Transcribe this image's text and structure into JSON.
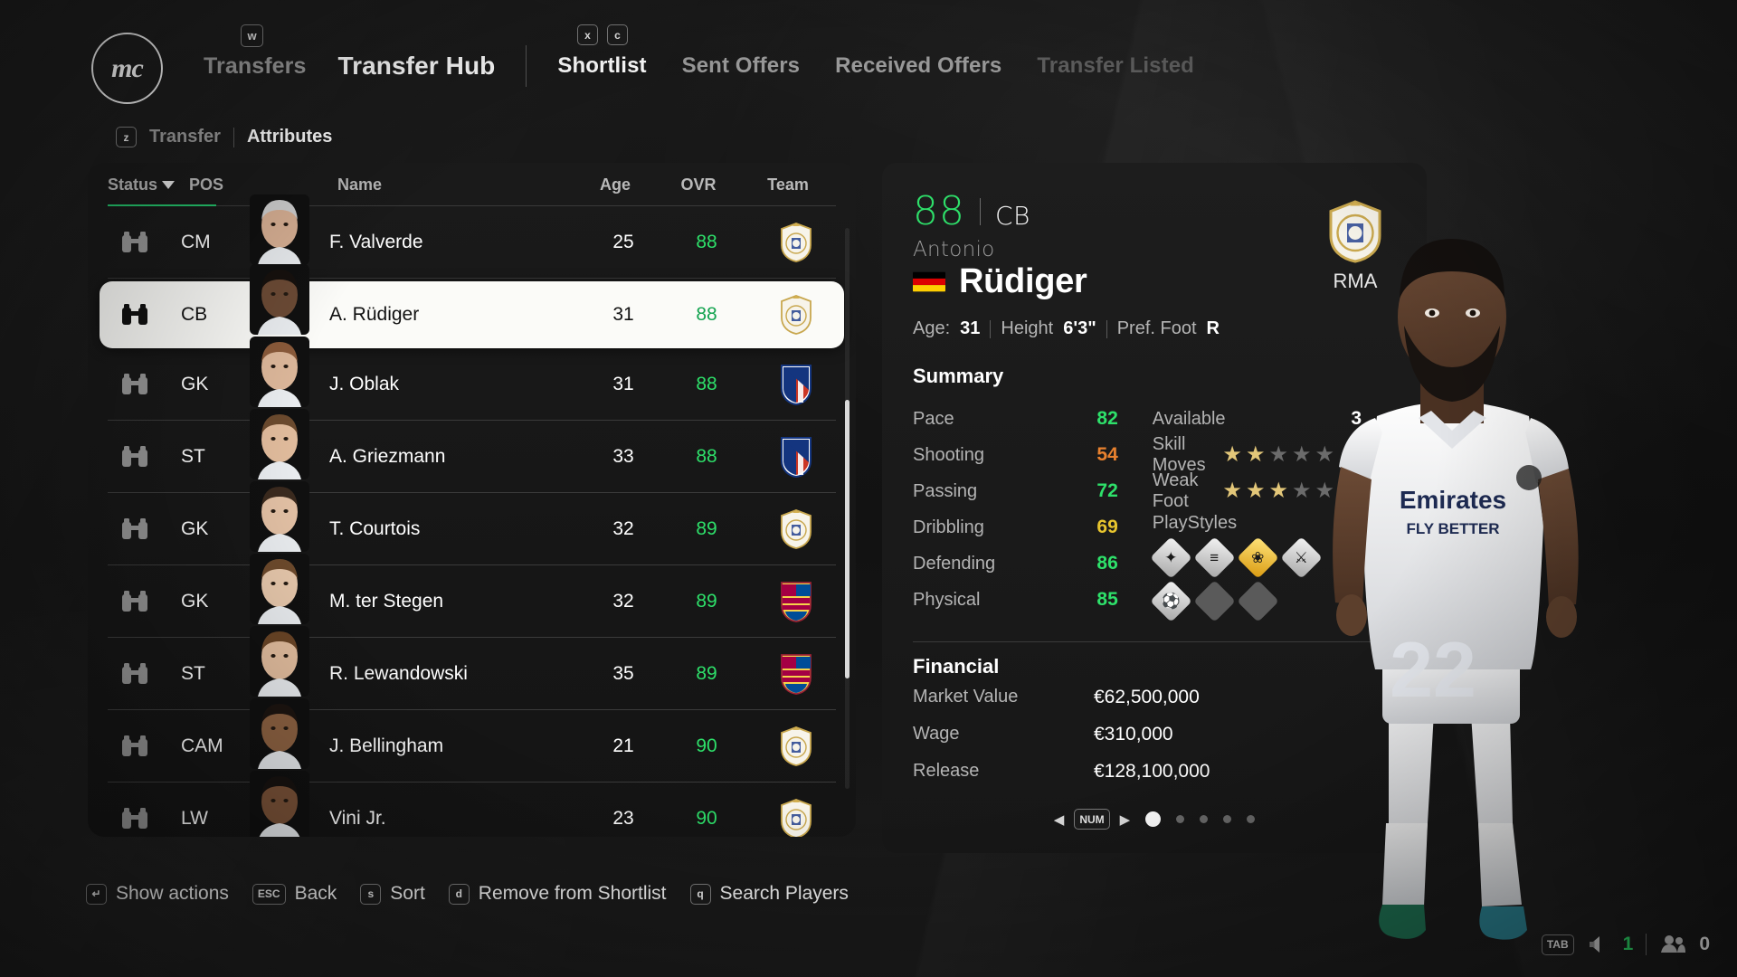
{
  "app": {
    "logo_text": "mc"
  },
  "header": {
    "hint_w": "w",
    "hint_x": "x",
    "hint_c": "c",
    "breadcrumb_parent": "Transfers",
    "title": "Transfer Hub",
    "tabs": [
      {
        "label": "Shortlist",
        "state": "active"
      },
      {
        "label": "Sent Offers",
        "state": "inactive"
      },
      {
        "label": "Received Offers",
        "state": "inactive"
      },
      {
        "label": "Transfer Listed",
        "state": "disabled"
      }
    ]
  },
  "subtabs": {
    "hint_z": "z",
    "items": [
      {
        "label": "Transfer",
        "state": "inactive"
      },
      {
        "label": "Attributes",
        "state": "active"
      }
    ]
  },
  "list": {
    "columns": {
      "status": "Status",
      "pos": "POS",
      "name": "Name",
      "age": "Age",
      "ovr": "OVR",
      "team": "Team"
    },
    "sort_indicator": "descending",
    "rows": [
      {
        "pos": "CM",
        "name": "F. Valverde",
        "age": "25",
        "ovr": "88",
        "team": "Real Madrid",
        "selected": false
      },
      {
        "pos": "CB",
        "name": "A. Rüdiger",
        "age": "31",
        "ovr": "88",
        "team": "Real Madrid",
        "selected": true
      },
      {
        "pos": "GK",
        "name": "J. Oblak",
        "age": "31",
        "ovr": "88",
        "team": "Atlético Madrid",
        "selected": false
      },
      {
        "pos": "ST",
        "name": "A. Griezmann",
        "age": "33",
        "ovr": "88",
        "team": "Atlético Madrid",
        "selected": false
      },
      {
        "pos": "GK",
        "name": "T. Courtois",
        "age": "32",
        "ovr": "89",
        "team": "Real Madrid",
        "selected": false
      },
      {
        "pos": "GK",
        "name": "M. ter Stegen",
        "age": "32",
        "ovr": "89",
        "team": "FC Barcelona",
        "selected": false
      },
      {
        "pos": "ST",
        "name": "R. Lewandowski",
        "age": "35",
        "ovr": "89",
        "team": "FC Barcelona",
        "selected": false
      },
      {
        "pos": "CAM",
        "name": "J. Bellingham",
        "age": "21",
        "ovr": "90",
        "team": "Real Madrid",
        "selected": false
      },
      {
        "pos": "LW",
        "name": "Vini Jr.",
        "age": "23",
        "ovr": "90",
        "team": "Real Madrid",
        "selected": false
      }
    ]
  },
  "detail": {
    "ovr": "88",
    "position": "CB",
    "first_name": "Antonio",
    "last_name": "Rüdiger",
    "nationality": "Germany",
    "club_abbr": "RMA",
    "bio": {
      "age_label": "Age:",
      "age_value": "31",
      "height_label": "Height",
      "height_value": "6'3\"",
      "foot_label": "Pref. Foot",
      "foot_value": "R"
    },
    "summary_title": "Summary",
    "attributes": [
      {
        "label": "Pace",
        "value": "82",
        "color": "green"
      },
      {
        "label": "Shooting",
        "value": "54",
        "color": "orange"
      },
      {
        "label": "Passing",
        "value": "72",
        "color": "green"
      },
      {
        "label": "Dribbling",
        "value": "69",
        "color": "yellow"
      },
      {
        "label": "Defending",
        "value": "86",
        "color": "green"
      },
      {
        "label": "Physical",
        "value": "85",
        "color": "green"
      }
    ],
    "available_label": "Available",
    "available_value": "3",
    "skill_moves_label": "Skill Moves",
    "skill_moves": 2,
    "weak_foot_label": "Weak Foot",
    "weak_foot": 3,
    "playstyles_label": "PlayStyles",
    "playstyles": [
      {
        "name": "aerial",
        "tier": "silver",
        "glyph": "✦"
      },
      {
        "name": "bruiser",
        "tier": "silver",
        "glyph": "≡"
      },
      {
        "name": "power-header",
        "tier": "gold",
        "glyph": "❀"
      },
      {
        "name": "slide-tackle",
        "tier": "silver",
        "glyph": "⚔"
      },
      {
        "name": "anticipate",
        "tier": "silver",
        "glyph": "⚽"
      },
      {
        "name": "empty-slot",
        "tier": "empty",
        "glyph": ""
      },
      {
        "name": "empty-slot",
        "tier": "empty",
        "glyph": ""
      }
    ],
    "financial_title": "Financial",
    "financial": [
      {
        "label": "Market Value",
        "value": "€62,500,000"
      },
      {
        "label": "Wage",
        "value": "€310,000"
      },
      {
        "label": "Release",
        "value": "€128,100,000"
      }
    ],
    "pager": {
      "key": "NUM",
      "left_arrow": "◀",
      "right_arrow": "▶",
      "pages": 5,
      "current": 1
    }
  },
  "bottom_bar": [
    {
      "key": "↵",
      "label": "Show actions"
    },
    {
      "key": "ESC",
      "label": "Back"
    },
    {
      "key": "s",
      "label": "Sort"
    },
    {
      "key": "d",
      "label": "Remove from Shortlist"
    },
    {
      "key": "q",
      "label": "Search Players"
    }
  ],
  "status_right": {
    "key": "TAB",
    "volume_icon": "speaker-icon",
    "volume_value": "1",
    "friends_icon": "people-icon",
    "friends_value": "0"
  },
  "colors": {
    "accent_green": "#2ee06a",
    "orange": "#e8812e",
    "yellow": "#e8c52e",
    "star_gold": "#e3c779"
  }
}
